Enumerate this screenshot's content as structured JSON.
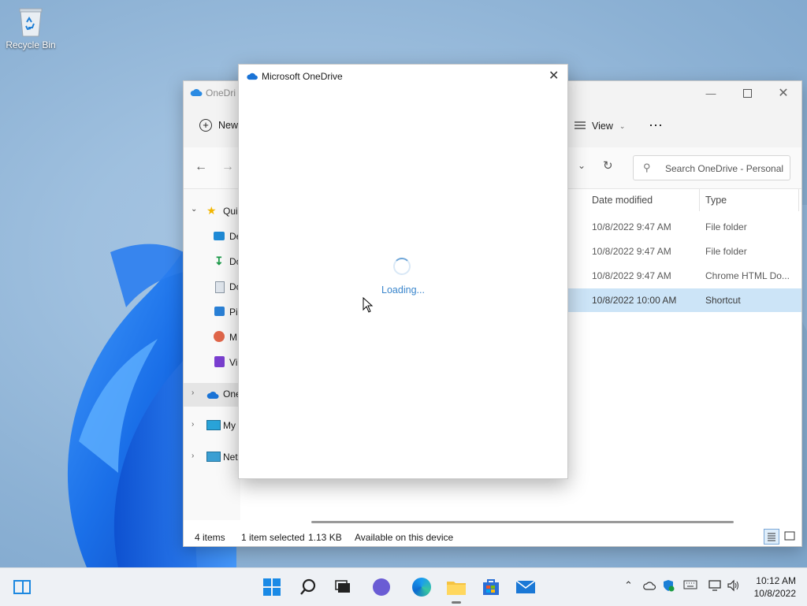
{
  "desktop": {
    "recycle_bin_label": "Recycle Bin"
  },
  "explorer": {
    "title": "OneDri",
    "new_label": "New",
    "view_label": "View",
    "more_label": "⋯",
    "search_placeholder": "Search OneDrive - Personal",
    "nav": [
      {
        "label": "Qui",
        "icon": "star-icon"
      },
      {
        "label": "De",
        "icon": "desktop-icon"
      },
      {
        "label": "Do",
        "icon": "downloads-icon"
      },
      {
        "label": "Do",
        "icon": "documents-icon"
      },
      {
        "label": "Pi",
        "icon": "pictures-icon"
      },
      {
        "label": "M",
        "icon": "music-icon"
      },
      {
        "label": "Vi",
        "icon": "videos-icon"
      },
      {
        "label": "One",
        "icon": "onedrive-icon"
      },
      {
        "label": "My",
        "icon": "this-pc-icon"
      },
      {
        "label": "Net",
        "icon": "network-icon"
      }
    ],
    "columns": {
      "date_modified": "Date modified",
      "type": "Type"
    },
    "rows": [
      {
        "date": "10/8/2022 9:47 AM",
        "type": "File folder"
      },
      {
        "date": "10/8/2022 9:47 AM",
        "type": "File folder"
      },
      {
        "date": "10/8/2022 9:47 AM",
        "type": "Chrome HTML Do..."
      },
      {
        "date": "10/8/2022 10:00 AM",
        "type": "Shortcut"
      }
    ],
    "status": {
      "items": "4 items",
      "selected": "1 item selected",
      "size": "1.13 KB",
      "availability": "Available on this device"
    }
  },
  "dialog": {
    "title": "Microsoft OneDrive",
    "loading_text": "Loading..."
  },
  "taskbar": {
    "time": "10:12 AM",
    "date": "10/8/2022"
  },
  "colors": {
    "accent": "#0078d4",
    "selected_row": "#cce4f7",
    "taskbar_bg": "#eef1f5"
  }
}
